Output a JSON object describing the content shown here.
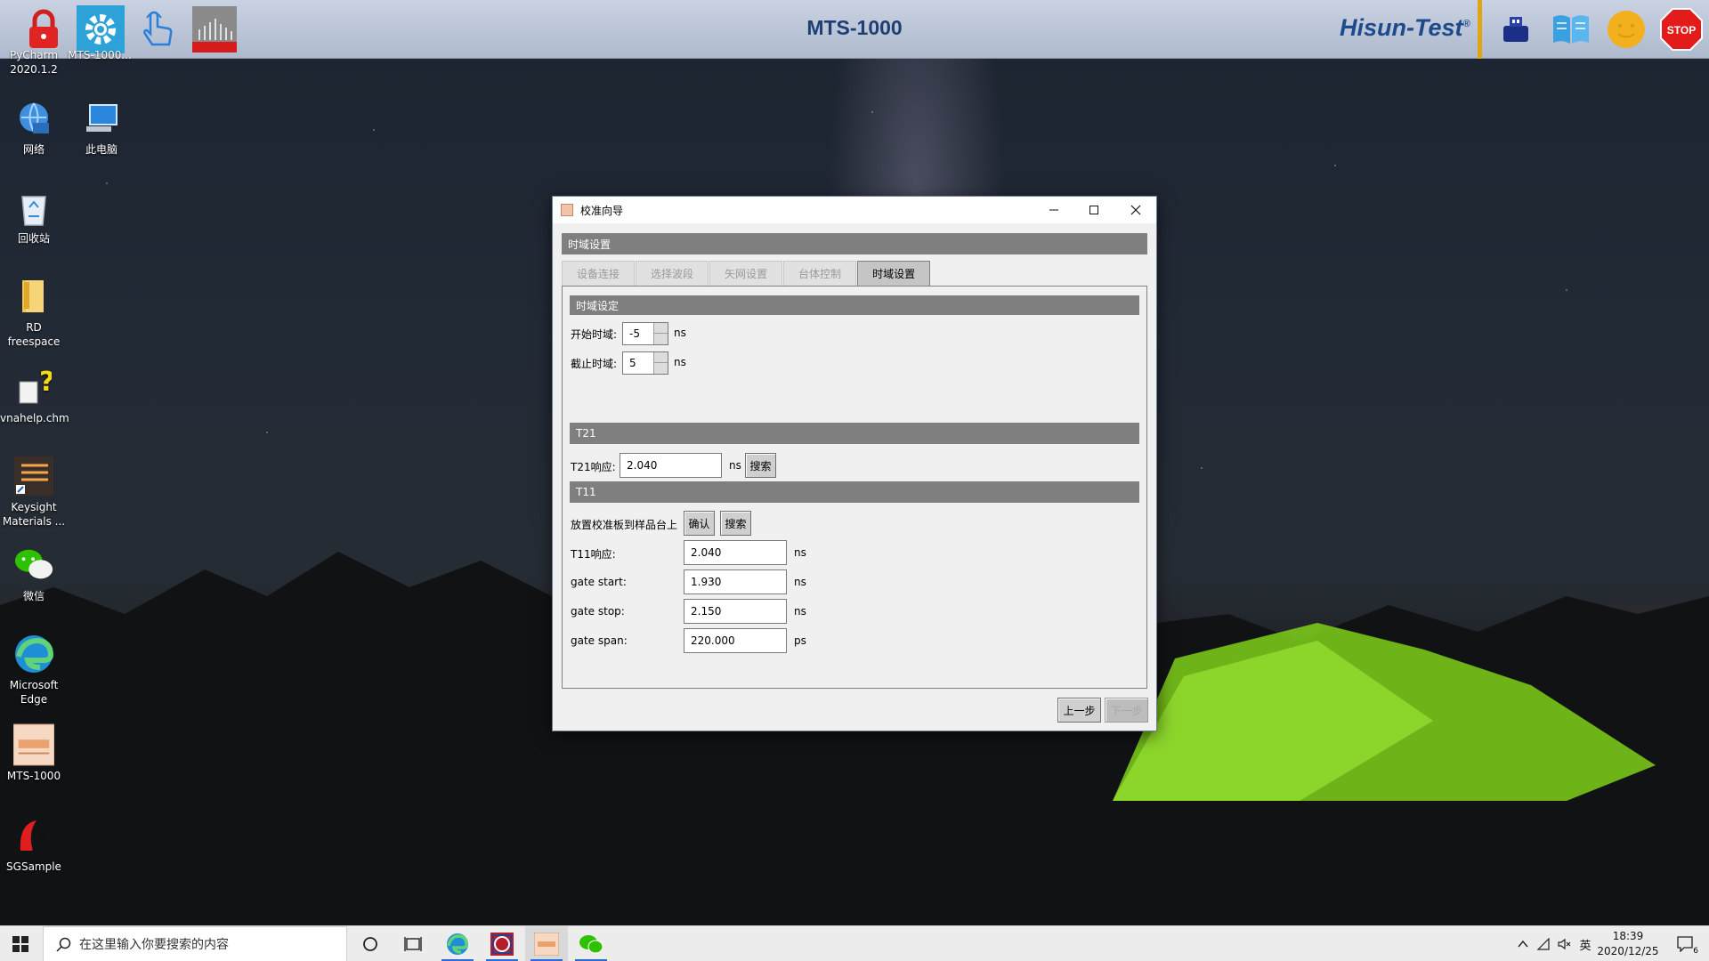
{
  "topbar": {
    "title": "MTS-1000",
    "brand": "Hisun-Test",
    "brand_mark": "®",
    "icons": [
      "lock-icon",
      "gear-icon",
      "touch-icon",
      "signal-analyzer-icon",
      "usb-device-icon",
      "book-icon",
      "smiley-icon",
      "stop-icon"
    ],
    "stop_label": "STOP"
  },
  "desktop": {
    "items": [
      {
        "label": "PyCharm 2020.1.2",
        "label_lines": [
          "PyCharm",
          "2020.1.2"
        ]
      },
      {
        "label": "MTS-1000...",
        "label_lines": [
          "MTS-1000..."
        ]
      },
      {
        "label": "网络",
        "label_lines": [
          "网络"
        ]
      },
      {
        "label": "此电脑",
        "label_lines": [
          "此电脑"
        ]
      },
      {
        "label": "回收站",
        "label_lines": [
          "回收站"
        ]
      },
      {
        "label": "RD freespace",
        "label_lines": [
          "RD",
          "freespace"
        ]
      },
      {
        "label": "vnahelp.chm",
        "label_lines": [
          "vnahelp.chm"
        ]
      },
      {
        "label": "Keysight Materials ...",
        "label_lines": [
          "Keysight",
          "Materials ..."
        ]
      },
      {
        "label": "微信",
        "label_lines": [
          "微信"
        ]
      },
      {
        "label": "Microsoft Edge",
        "label_lines": [
          "Microsoft",
          "Edge"
        ]
      },
      {
        "label": "MTS-1000",
        "label_lines": [
          "MTS-1000"
        ]
      },
      {
        "label": "SGSample",
        "label_lines": [
          "SGSample"
        ]
      }
    ]
  },
  "dialog": {
    "title": "校准向导",
    "section_title": "时域设置",
    "tabs": [
      {
        "label": "设备连接",
        "active": false
      },
      {
        "label": "选择波段",
        "active": false
      },
      {
        "label": "矢网设置",
        "active": false
      },
      {
        "label": "台体控制",
        "active": false
      },
      {
        "label": "时域设置",
        "active": true
      }
    ],
    "time_domain": {
      "header": "时域设定",
      "start_label": "开始时域:",
      "start_value": "-5",
      "stop_label": "截止时域:",
      "stop_value": "5",
      "unit": "ns"
    },
    "t21": {
      "header": "T21",
      "response_label": "T21响应:",
      "response_value": "2.040",
      "unit": "ns",
      "search_button": "搜索"
    },
    "t11": {
      "header": "T11",
      "place_label": "放置校准板到样品台上",
      "confirm_button": "确认",
      "search_button": "搜索",
      "rows": [
        {
          "label": "T11响应:",
          "value": "2.040",
          "unit": "ns"
        },
        {
          "label": "gate start:",
          "value": "1.930",
          "unit": "ns"
        },
        {
          "label": "gate stop:",
          "value": "2.150",
          "unit": "ns"
        },
        {
          "label": "gate span:",
          "value": "220.000",
          "unit": "ps"
        }
      ]
    },
    "prev_button": "上一步",
    "next_button": "下一步"
  },
  "taskbar": {
    "search_placeholder": "在这里输入你要搜索的内容",
    "ime": "英",
    "time": "18:39",
    "date": "2020/12/25",
    "notification_count": "6"
  }
}
